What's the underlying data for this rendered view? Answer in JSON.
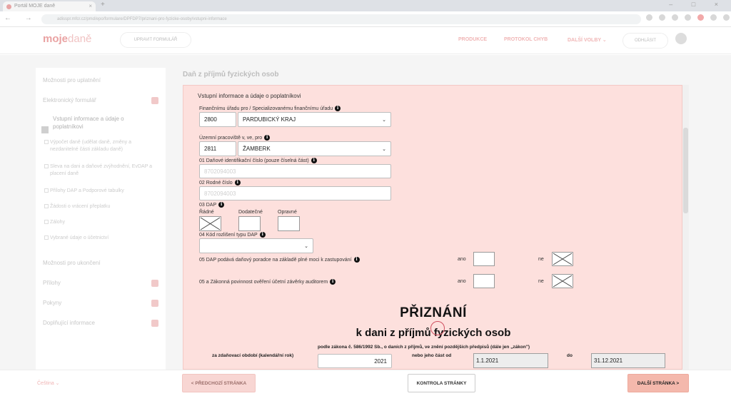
{
  "browser": {
    "tab_title": "Portál MOJE daně",
    "url": "adisspr.mfcr.cz/pmd/epo/formulare/DPFDP7/priznani-pro-fyzicke-osoby/vstupni-informace",
    "close_glyph": "×",
    "new_tab_glyph": "+",
    "window_controls": "– □ ×",
    "nav_glyphs": "← → ⟳"
  },
  "header": {
    "logo_main": "moje",
    "logo_sub": "daně",
    "print_button": "UPRAVIT FORMULÁŘ",
    "nav": [
      "PRODUKCE",
      "PROTOKOL CHYB",
      "DALŠÍ VOLBY ⌄"
    ],
    "login_button": "ODHLÁSIT"
  },
  "sidebar": {
    "items": [
      {
        "label": "Možnosti pro uplatnění"
      },
      {
        "label": "Elektronický formulář"
      },
      {
        "label": "Vstupní informace a údaje o poplatníkovi"
      },
      {
        "label": "Výpočet daně (udělat daně, změny a nezdanitelné části základu daně)"
      },
      {
        "label": "Sleva na dani a daňové zvýhodnění, EvDAP a placení daně"
      },
      {
        "label": "Přílohy DAP a Podporové tabulky"
      },
      {
        "label": "Žádosti o vrácení přeplatku"
      },
      {
        "label": "Zálohy"
      },
      {
        "label": "Vybrané údaje o účetnictví"
      },
      {
        "label": "Možnosti pro ukončení"
      },
      {
        "label": "Přílohy"
      },
      {
        "label": "Pokyny"
      },
      {
        "label": "Doplňující informace"
      }
    ]
  },
  "page": {
    "heading": "Daň z příjmů fyzických osob"
  },
  "form": {
    "section_title": "Vstupní informace a údaje o poplatníkovi",
    "fin_office": {
      "label": "Finančnímu úřadu pro / Specializovanému finančnímu úřadu",
      "code": "2800",
      "value": "PARDUBICKÝ KRAJ"
    },
    "territorial": {
      "label": "Územní pracoviště v, ve, pro",
      "code": "2811",
      "value": "ŽAMBERK"
    },
    "dic": {
      "label": "01 Daňové identifikační číslo (pouze číselná část)",
      "value": "8702094003"
    },
    "rc": {
      "label": "02 Rodné číslo",
      "value": "8702094003"
    },
    "dap": {
      "label": "03 DAP",
      "options": [
        "Řádné",
        "Dodatečné",
        "Opravné"
      ],
      "selected": 0
    },
    "kod": {
      "label": "04 Kód rozlišení typu DAP",
      "value": ""
    },
    "q05": {
      "label": "05 DAP podává daňový poradce na základě plné moci k zastupování",
      "yes": "ano",
      "no": "ne",
      "answer": "ne"
    },
    "q05a": {
      "label": "05 a Zákonná povinnost ověření účetní závěrky auditorem",
      "yes": "ano",
      "no": "ne",
      "answer": "ne"
    },
    "title_main": "PŘIZNÁNÍ",
    "title_sub": "k dani z příjmů fyzických osob",
    "law_text": "podle zákona č. 586/1992 Sb., o daních z příjmů, ve znění pozdějších předpisů (dále jen „zákon\")",
    "period_label": "za zdaňovací období (kalendářní rok)",
    "year": "2021",
    "part_from_label": "nebo jeho část od",
    "from_date": "1.1.2021",
    "to_label": "do",
    "to_date": "31.12.2021",
    "info_glyph": "i",
    "chevron_glyph": "⌄"
  },
  "footer": {
    "language": "Čeština ⌄",
    "prev_button": "< PŘEDCHOZÍ STRÁNKA",
    "check_button": "KONTROLA STRÁNKY",
    "next_button": "DALŠÍ STRÁNKA >"
  }
}
